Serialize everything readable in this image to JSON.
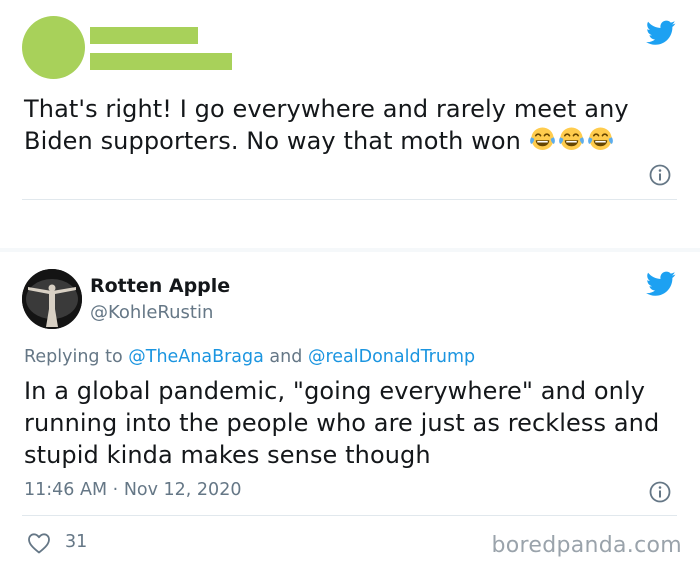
{
  "colors": {
    "redaction": "#a8d15a",
    "twitter_blue": "#1da1f2",
    "mention_blue": "#1b95e0",
    "secondary_text": "#657786"
  },
  "tweet1": {
    "text": "That's right! I go everywhere and rarely meet any Biden supporters. No way that moth won",
    "emojis": [
      "face-with-tears-of-joy",
      "face-with-tears-of-joy",
      "face-with-tears-of-joy"
    ],
    "icons": [
      "twitter-bird-icon",
      "info-icon"
    ]
  },
  "tweet2": {
    "display_name": "Rotten Apple",
    "handle": "@KohleRustin",
    "reply_prefix": "Replying to",
    "reply_to": [
      "@TheAnaBraga",
      "@realDonaldTrump"
    ],
    "reply_joiner": "and",
    "text": "In a global pandemic, \"going everywhere\" and only running into the people who are just as reckless and stupid kinda makes sense though",
    "time": "11:46 AM",
    "separator": "·",
    "date": "Nov 12, 2020",
    "like_count": "31",
    "icons": [
      "twitter-bird-icon",
      "info-icon",
      "heart-icon"
    ]
  },
  "watermark": "boredpanda.com"
}
